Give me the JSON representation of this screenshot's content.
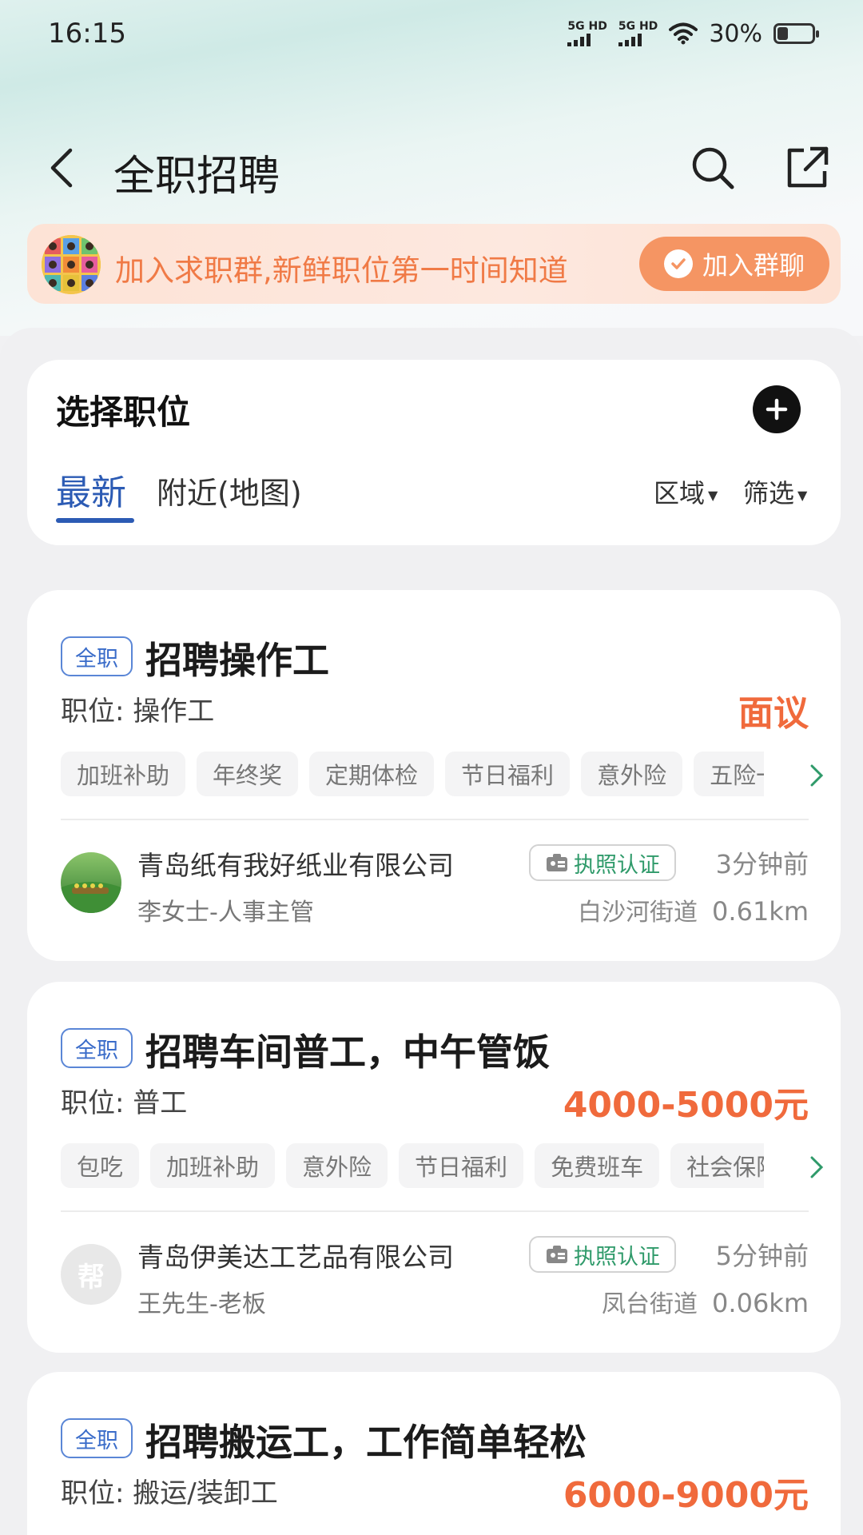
{
  "status_bar": {
    "time": "16:15",
    "signal_1_label": "5G HD",
    "signal_2_label": "5G HD",
    "battery": "30%"
  },
  "header": {
    "title": "全职招聘"
  },
  "banner": {
    "text": "加入求职群,新鲜职位第一时间知道",
    "button_label": "加入群聊"
  },
  "selector": {
    "title": "选择职位",
    "tabs": [
      "最新",
      "附近(地图)"
    ],
    "active_tab": "最新",
    "filters": [
      "区域",
      "筛选"
    ]
  },
  "jobs": [
    {
      "type": "全职",
      "title": "招聘操作工",
      "position_label": "职位:",
      "position": "操作工",
      "salary": "面议",
      "tags": [
        "加班补助",
        "年终奖",
        "定期体检",
        "节日福利",
        "意外险",
        "五险一金"
      ],
      "company": "青岛纸有我好纸业有限公司",
      "contact": "李女士-人事主管",
      "license": "执照认证",
      "posted": "3分钟前",
      "street": "白沙河街道",
      "distance": "0.61km",
      "avatar_text": ""
    },
    {
      "type": "全职",
      "title": "招聘车间普工，中午管饭",
      "position_label": "职位:",
      "position": "普工",
      "salary": "4000-5000元",
      "tags": [
        "包吃",
        "加班补助",
        "意外险",
        "节日福利",
        "免费班车",
        "社会保险"
      ],
      "company": "青岛伊美达工艺品有限公司",
      "contact": "王先生-老板",
      "license": "执照认证",
      "posted": "5分钟前",
      "street": "凤台街道",
      "distance": "0.06km",
      "avatar_text": "帮"
    },
    {
      "type": "全职",
      "title": "招聘搬运工，工作简单轻松",
      "position_label": "职位:",
      "position": "搬运/装卸工",
      "salary": "6000-9000元"
    }
  ],
  "colors": {
    "accent_blue": "#2c5bb4",
    "salary_orange": "#f06a3c",
    "banner_orange": "#f59563",
    "license_green": "#2f9a6a"
  }
}
